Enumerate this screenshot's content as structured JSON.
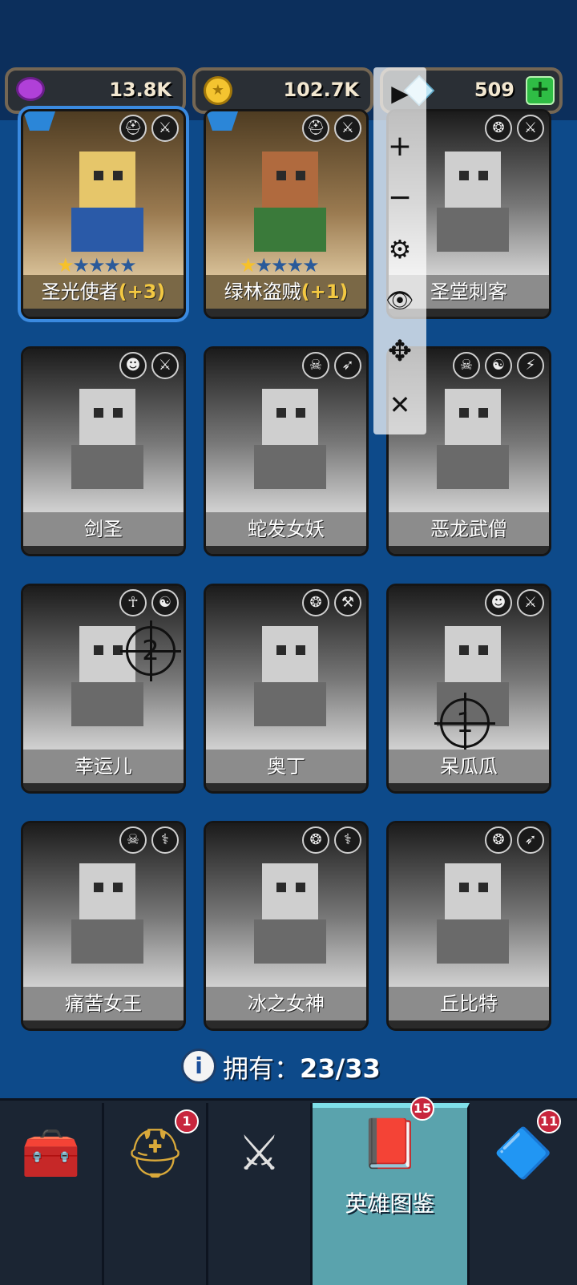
{
  "currencies": {
    "purple": {
      "value": "13.8K",
      "icon": "purple-gem-icon"
    },
    "gold": {
      "value": "102.7K",
      "icon": "gold-coin-icon"
    },
    "diamond": {
      "value": "509",
      "icon": "diamond-icon",
      "add": "+"
    }
  },
  "heroes": [
    {
      "name": "圣光使者",
      "bonus": "(+3)",
      "owned": true,
      "stars": "★★★★★",
      "lit_stars": 1,
      "badges": [
        "⛑",
        "⚔"
      ]
    },
    {
      "name": "绿林盗贼",
      "bonus": "(+1)",
      "owned": true,
      "stars": "★★★★★",
      "lit_stars": 1,
      "badges": [
        "⛑",
        "⚔"
      ]
    },
    {
      "name": "圣堂刺客",
      "bonus": "",
      "owned": false,
      "badges": [
        "❂",
        "⚔"
      ]
    },
    {
      "name": "剑圣",
      "bonus": "",
      "owned": false,
      "badges": [
        "☻",
        "⚔"
      ]
    },
    {
      "name": "蛇发女妖",
      "bonus": "",
      "owned": false,
      "badges": [
        "☠",
        "➶"
      ]
    },
    {
      "name": "恶龙武僧",
      "bonus": "",
      "owned": false,
      "badges": [
        "☠",
        "☯",
        "⚡"
      ]
    },
    {
      "name": "幸运儿",
      "bonus": "",
      "owned": false,
      "badges": [
        "☥",
        "☯"
      ],
      "target": "2"
    },
    {
      "name": "奥丁",
      "bonus": "",
      "owned": false,
      "badges": [
        "❂",
        "⚒"
      ]
    },
    {
      "name": "呆瓜瓜",
      "bonus": "",
      "owned": false,
      "badges": [
        "☻",
        "⚔"
      ],
      "target": "1"
    },
    {
      "name": "痛苦女王",
      "bonus": "",
      "owned": false,
      "badges": [
        "☠",
        "⚕"
      ]
    },
    {
      "name": "冰之女神",
      "bonus": "",
      "owned": false,
      "badges": [
        "❂",
        "⚕"
      ]
    },
    {
      "name": "丘比特",
      "bonus": "",
      "owned": false,
      "badges": [
        "❂",
        "➶"
      ]
    }
  ],
  "owned_summary": {
    "label": "拥有：",
    "count": "23/33",
    "icon": "info-icon"
  },
  "toolbar": {
    "play": "▶",
    "zoom_in": "+",
    "zoom_out": "−",
    "settings": "⚙",
    "hide": "👁",
    "move": "✥",
    "close": "✕"
  },
  "nav": [
    {
      "icon": "treasure-chest-icon",
      "glyph": "🧰",
      "badge": ""
    },
    {
      "icon": "viking-helmet-icon",
      "glyph": "⛑",
      "badge": "1"
    },
    {
      "icon": "crossed-swords-icon",
      "glyph": "⚔",
      "badge": ""
    },
    {
      "icon": "hero-book-icon",
      "glyph": "📕",
      "label": "英雄图鉴",
      "badge": "15",
      "active": true
    },
    {
      "icon": "amulet-icon",
      "glyph": "🔷",
      "badge": "11"
    }
  ]
}
